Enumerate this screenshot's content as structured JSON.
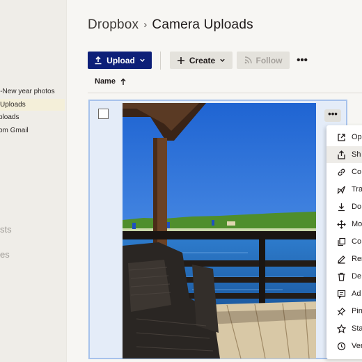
{
  "sidebar": {
    "items": [
      {
        "label": "l-New year photos",
        "active": false
      },
      {
        "label": "Uploads",
        "active": true
      },
      {
        "label": "ploads",
        "active": false
      },
      {
        "label": "om Gmail",
        "active": false
      }
    ],
    "faded": [
      "sts",
      "es"
    ]
  },
  "breadcrumb": {
    "root": "Dropbox",
    "separator": "›",
    "current": "Camera Uploads"
  },
  "toolbar": {
    "upload_label": "Upload",
    "create_label": "Create",
    "follow_label": "Follow",
    "more_label": "•••"
  },
  "table": {
    "name_header": "Name",
    "sort_direction": "ascending"
  },
  "card": {
    "more_label": "•••",
    "checked": false
  },
  "context_menu": {
    "items": [
      {
        "label": "Op",
        "icon": "open-external-icon"
      },
      {
        "label": "Sh",
        "icon": "share-icon",
        "highlighted": true
      },
      {
        "label": "Co",
        "icon": "link-icon"
      },
      {
        "label": "Tra",
        "icon": "send-icon"
      },
      {
        "label": "Do",
        "icon": "download-icon"
      },
      {
        "label": "Mo",
        "icon": "move-icon"
      },
      {
        "label": "Co",
        "icon": "copy-icon"
      },
      {
        "label": "Ren",
        "icon": "pencil-icon"
      },
      {
        "label": "De",
        "icon": "trash-icon"
      },
      {
        "label": "Ad",
        "icon": "comment-icon"
      },
      {
        "label": "Pin",
        "icon": "pin-icon"
      },
      {
        "label": "Sta",
        "icon": "star-icon"
      },
      {
        "label": "Ver",
        "icon": "history-icon"
      }
    ]
  },
  "colors": {
    "primary": "#0d1f78",
    "selection_border": "#a7c2ec",
    "selection_bg": "#e4ecf8"
  }
}
